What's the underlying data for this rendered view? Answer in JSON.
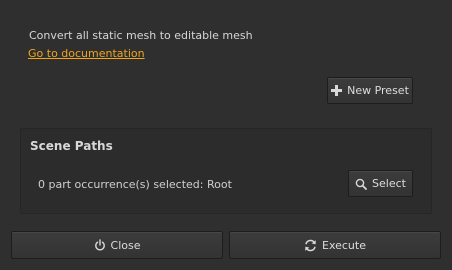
{
  "description": "Convert all static mesh to editable mesh",
  "documentation_link": "Go to documentation",
  "toolbar": {
    "new_preset_label": "New Preset",
    "new_preset_icon": "plus-icon"
  },
  "scene_paths": {
    "title": "Scene Paths",
    "selection_text": "0 part occurrence(s) selected: Root",
    "select_label": "Select",
    "select_icon": "magnifier-icon"
  },
  "footer": {
    "close_label": "Close",
    "close_icon": "power-icon",
    "execute_label": "Execute",
    "execute_icon": "refresh-icon"
  },
  "colors": {
    "background": "#2f2f2f",
    "link": "#f0a51c",
    "text": "#cfcfcf"
  }
}
